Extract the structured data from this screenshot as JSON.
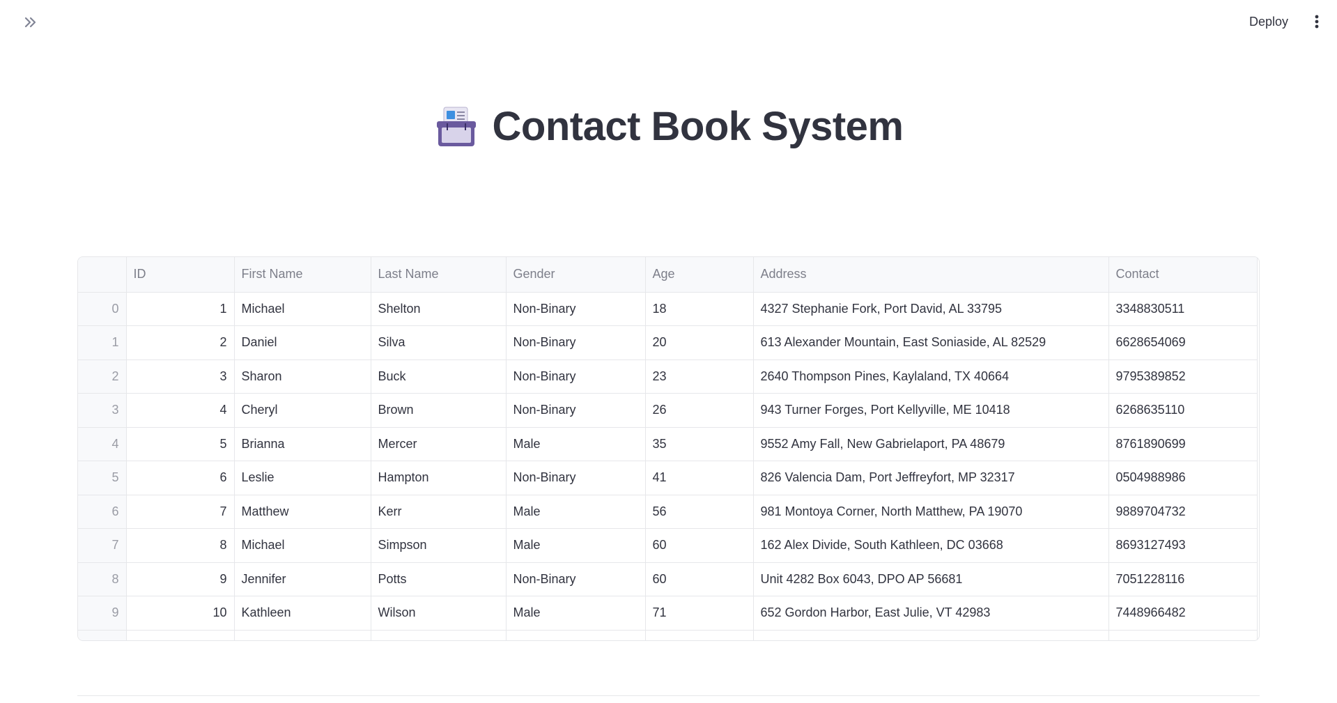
{
  "toolbar": {
    "deploy_label": "Deploy"
  },
  "page": {
    "title": "Contact Book System",
    "title_icon": "card-index-icon"
  },
  "table": {
    "columns": [
      "",
      "ID",
      "First Name",
      "Last Name",
      "Gender",
      "Age",
      "Address",
      "Contact"
    ],
    "rows": [
      {
        "index": "0",
        "id": "1",
        "first": "Michael",
        "last": "Shelton",
        "gender": "Non-Binary",
        "age": "18",
        "address": "4327 Stephanie Fork, Port David, AL 33795",
        "contact": "3348830511"
      },
      {
        "index": "1",
        "id": "2",
        "first": "Daniel",
        "last": "Silva",
        "gender": "Non-Binary",
        "age": "20",
        "address": "613 Alexander Mountain, East Soniaside, AL 82529",
        "contact": "6628654069"
      },
      {
        "index": "2",
        "id": "3",
        "first": "Sharon",
        "last": "Buck",
        "gender": "Non-Binary",
        "age": "23",
        "address": "2640 Thompson Pines, Kaylaland, TX 40664",
        "contact": "9795389852"
      },
      {
        "index": "3",
        "id": "4",
        "first": "Cheryl",
        "last": "Brown",
        "gender": "Non-Binary",
        "age": "26",
        "address": "943 Turner Forges, Port Kellyville, ME 10418",
        "contact": "6268635110"
      },
      {
        "index": "4",
        "id": "5",
        "first": "Brianna",
        "last": "Mercer",
        "gender": "Male",
        "age": "35",
        "address": "9552 Amy Fall, New Gabrielaport, PA 48679",
        "contact": "8761890699"
      },
      {
        "index": "5",
        "id": "6",
        "first": "Leslie",
        "last": "Hampton",
        "gender": "Non-Binary",
        "age": "41",
        "address": "826 Valencia Dam, Port Jeffreyfort, MP 32317",
        "contact": "0504988986"
      },
      {
        "index": "6",
        "id": "7",
        "first": "Matthew",
        "last": "Kerr",
        "gender": "Male",
        "age": "56",
        "address": "981 Montoya Corner, North Matthew, PA 19070",
        "contact": "9889704732"
      },
      {
        "index": "7",
        "id": "8",
        "first": "Michael",
        "last": "Simpson",
        "gender": "Male",
        "age": "60",
        "address": "162 Alex Divide, South Kathleen, DC 03668",
        "contact": "8693127493"
      },
      {
        "index": "8",
        "id": "9",
        "first": "Jennifer",
        "last": "Potts",
        "gender": "Non-Binary",
        "age": "60",
        "address": "Unit 4282 Box 6043, DPO AP 56681",
        "contact": "7051228116"
      },
      {
        "index": "9",
        "id": "10",
        "first": "Kathleen",
        "last": "Wilson",
        "gender": "Male",
        "age": "71",
        "address": "652 Gordon Harbor, East Julie, VT 42983",
        "contact": "7448966482"
      }
    ]
  },
  "colors": {
    "text": "#31333f",
    "header_text": "#7d7f8a",
    "grid": "#e6e7ea",
    "header_bg": "#f8f9fb"
  }
}
